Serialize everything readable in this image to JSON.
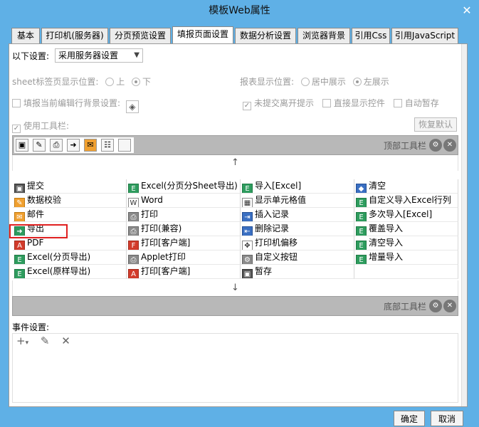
{
  "window": {
    "title": "模板Web属性",
    "close": "✕"
  },
  "tabs": [
    {
      "label": "基本"
    },
    {
      "label": "打印机(服务器)"
    },
    {
      "label": "分页预览设置"
    },
    {
      "label": "填报页面设置"
    },
    {
      "label": "数据分析设置"
    },
    {
      "label": "浏览器背景"
    },
    {
      "label": "引用Css"
    },
    {
      "label": "引用JavaScript"
    }
  ],
  "settings": {
    "label": "以下设置:",
    "select_value": "采用服务器设置",
    "sheet_pos_label": "sheet标签页显示位置:",
    "sheet_pos_up": "上",
    "sheet_pos_down": "下",
    "report_pos_label": "报表显示位置:",
    "report_pos_center": "居中展示",
    "report_pos_left": "左展示",
    "fill_bg_label": "填报当前编辑行背景设置:",
    "unsubmitted_warn": "未提交离开提示",
    "direct_show": "直接显示控件",
    "auto_save": "自动暂存",
    "use_toolbar": "使用工具栏:",
    "restore_default": "恢复默认"
  },
  "toolbar_top": {
    "label": "顶部工具栏",
    "icons": [
      "save-icon",
      "pencil-icon",
      "print-icon",
      "export-icon",
      "mail-icon",
      "tree-icon",
      "blank-icon"
    ]
  },
  "toolbar_bottom": {
    "label": "底部工具栏"
  },
  "arrows": {
    "up": "↑",
    "down": "↓"
  },
  "grid": [
    [
      {
        "icon": "floppy-icon",
        "color": "dark",
        "text": "提交"
      },
      {
        "icon": "excel-icon",
        "color": "green",
        "text": "Excel(分页分Sheet导出)"
      },
      {
        "icon": "excel-icon",
        "color": "green",
        "text": "导入[Excel]"
      },
      {
        "icon": "eraser-icon",
        "color": "blue",
        "text": "清空"
      }
    ],
    [
      {
        "icon": "pencil-icon",
        "color": "orange",
        "text": "数据校验"
      },
      {
        "icon": "word-icon",
        "color": "white",
        "text": "Word"
      },
      {
        "icon": "grid-icon",
        "color": "white",
        "text": "显示单元格值"
      },
      {
        "icon": "excel-icon",
        "color": "green",
        "text": "自定义导入Excel行列"
      }
    ],
    [
      {
        "icon": "mail-icon",
        "color": "orange",
        "text": "邮件"
      },
      {
        "icon": "print-icon",
        "color": "gray2",
        "text": "打印"
      },
      {
        "icon": "insert-row-icon",
        "color": "blue",
        "text": "插入记录"
      },
      {
        "icon": "excel-icon",
        "color": "green",
        "text": "多次导入[Excel]"
      }
    ],
    [
      {
        "icon": "export-icon",
        "color": "green",
        "text": "导出"
      },
      {
        "icon": "print-icon",
        "color": "gray2",
        "text": "打印(兼容)"
      },
      {
        "icon": "delete-row-icon",
        "color": "blue",
        "text": "删除记录"
      },
      {
        "icon": "excel-icon",
        "color": "green",
        "text": "覆盖导入"
      }
    ],
    [
      {
        "icon": "pdf-icon",
        "color": "red",
        "text": "PDF"
      },
      {
        "icon": "flash-print-icon",
        "color": "red",
        "text": "打印[客户端]"
      },
      {
        "icon": "move-icon",
        "color": "white",
        "text": "打印机偏移"
      },
      {
        "icon": "excel-icon",
        "color": "green",
        "text": "清空导入"
      }
    ],
    [
      {
        "icon": "excel-icon",
        "color": "green",
        "text": "Excel(分页导出)"
      },
      {
        "icon": "print-icon",
        "color": "gray2",
        "text": "Applet打印"
      },
      {
        "icon": "gear-icon",
        "color": "gray2",
        "text": "自定义按钮"
      },
      {
        "icon": "excel-icon",
        "color": "green",
        "text": "增量导入"
      }
    ],
    [
      {
        "icon": "excel-icon",
        "color": "green",
        "text": "Excel(原样导出)"
      },
      {
        "icon": "pdf-icon",
        "color": "red",
        "text": "打印[客户端]"
      },
      {
        "icon": "floppy-icon",
        "color": "dark",
        "text": "暂存"
      },
      {
        "icon": "",
        "color": "",
        "text": ""
      }
    ]
  ],
  "events": {
    "label": "事件设置:",
    "add": "+",
    "add_caret": "▾",
    "edit": "✎",
    "delete": "✕"
  },
  "footer": {
    "ok": "确定",
    "cancel": "取消"
  }
}
